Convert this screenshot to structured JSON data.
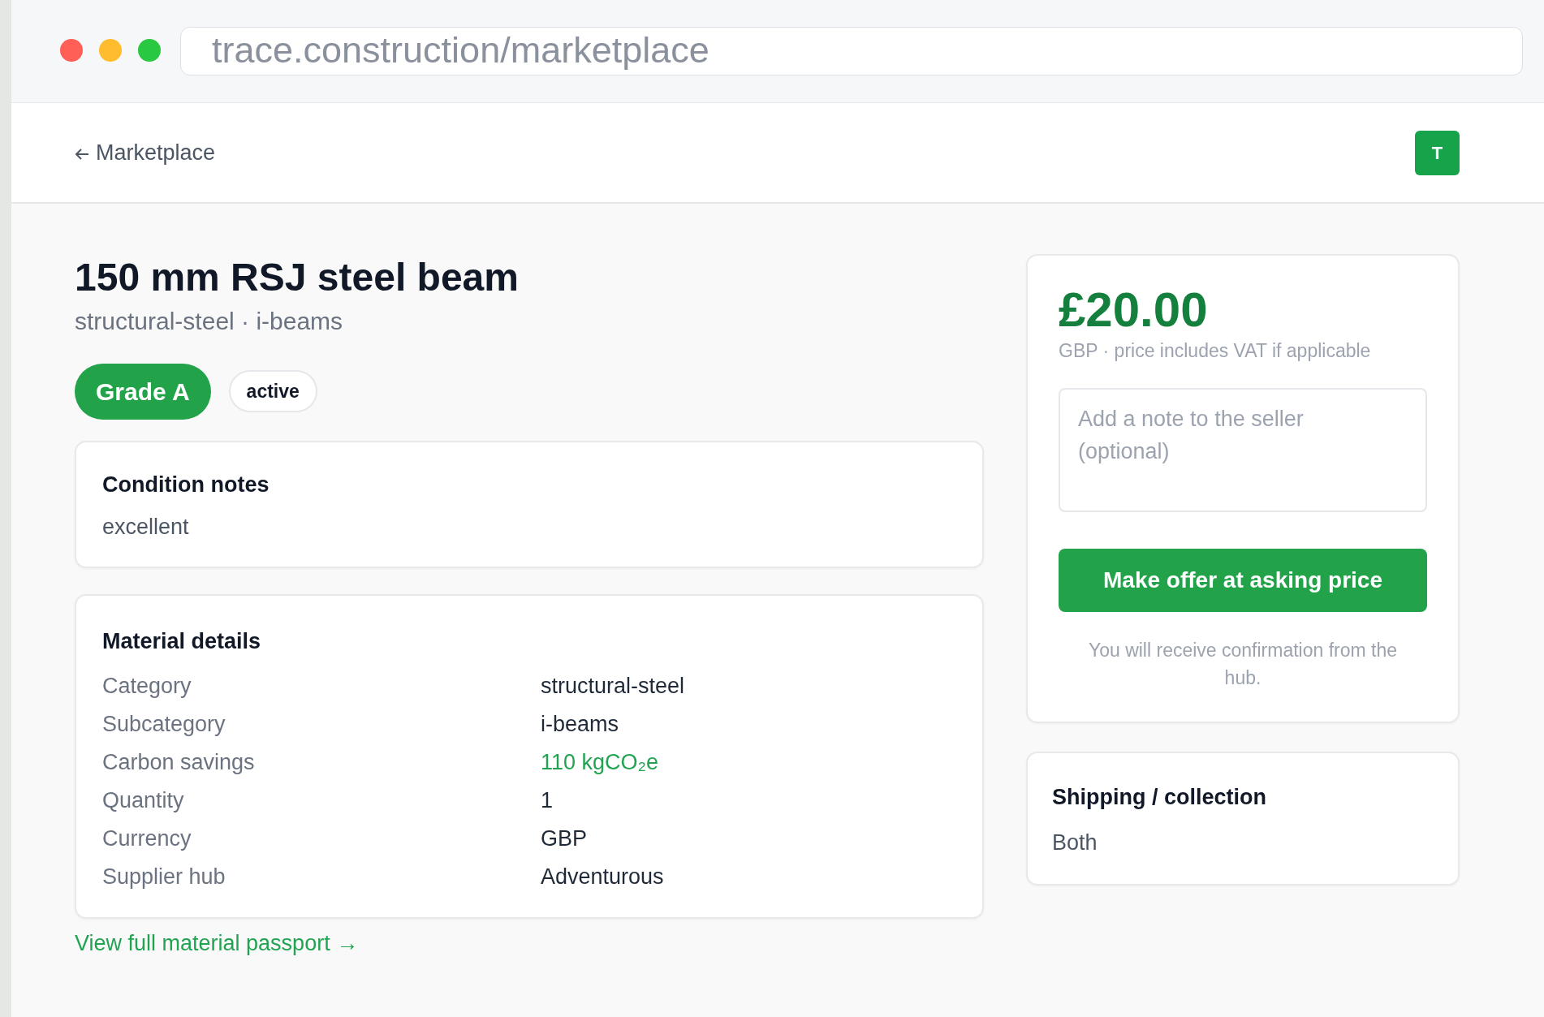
{
  "browser": {
    "url": "trace.construction/marketplace"
  },
  "header": {
    "back_link": "Marketplace",
    "avatar": "T"
  },
  "listing": {
    "title": "150 mm RSJ steel beam",
    "subtitle": "structural-steel · i-beams",
    "grade": "Grade A",
    "status": "active"
  },
  "condition": {
    "heading": "Condition notes",
    "text": "excellent"
  },
  "details": {
    "heading": "Material details",
    "rows": [
      {
        "label": "Category",
        "value": "structural-steel",
        "color": "#1f2937"
      },
      {
        "label": "Subcategory",
        "value": "i-beams",
        "color": "#1f2937"
      },
      {
        "label": "Carbon savings",
        "value": "110 kgCO₂e",
        "color": "#22a352"
      },
      {
        "label": "Quantity",
        "value": "1",
        "color": "#1f2937"
      },
      {
        "label": "Currency",
        "value": "GBP",
        "color": "#1f2937"
      },
      {
        "label": "Supplier hub",
        "value": "Adventurous",
        "color": "#1f2937"
      }
    ]
  },
  "passport_link": "View full material passport →",
  "offer": {
    "price": "£20.00",
    "price_note": "GBP · price includes VAT if applicable",
    "note": {
      "placeholder": "Add a note to the seller (optional)"
    },
    "button": "Make offer at asking price",
    "footnote": "You will receive confirmation from the hub."
  },
  "shipping": {
    "heading": "Shipping / collection",
    "text": "Both"
  }
}
